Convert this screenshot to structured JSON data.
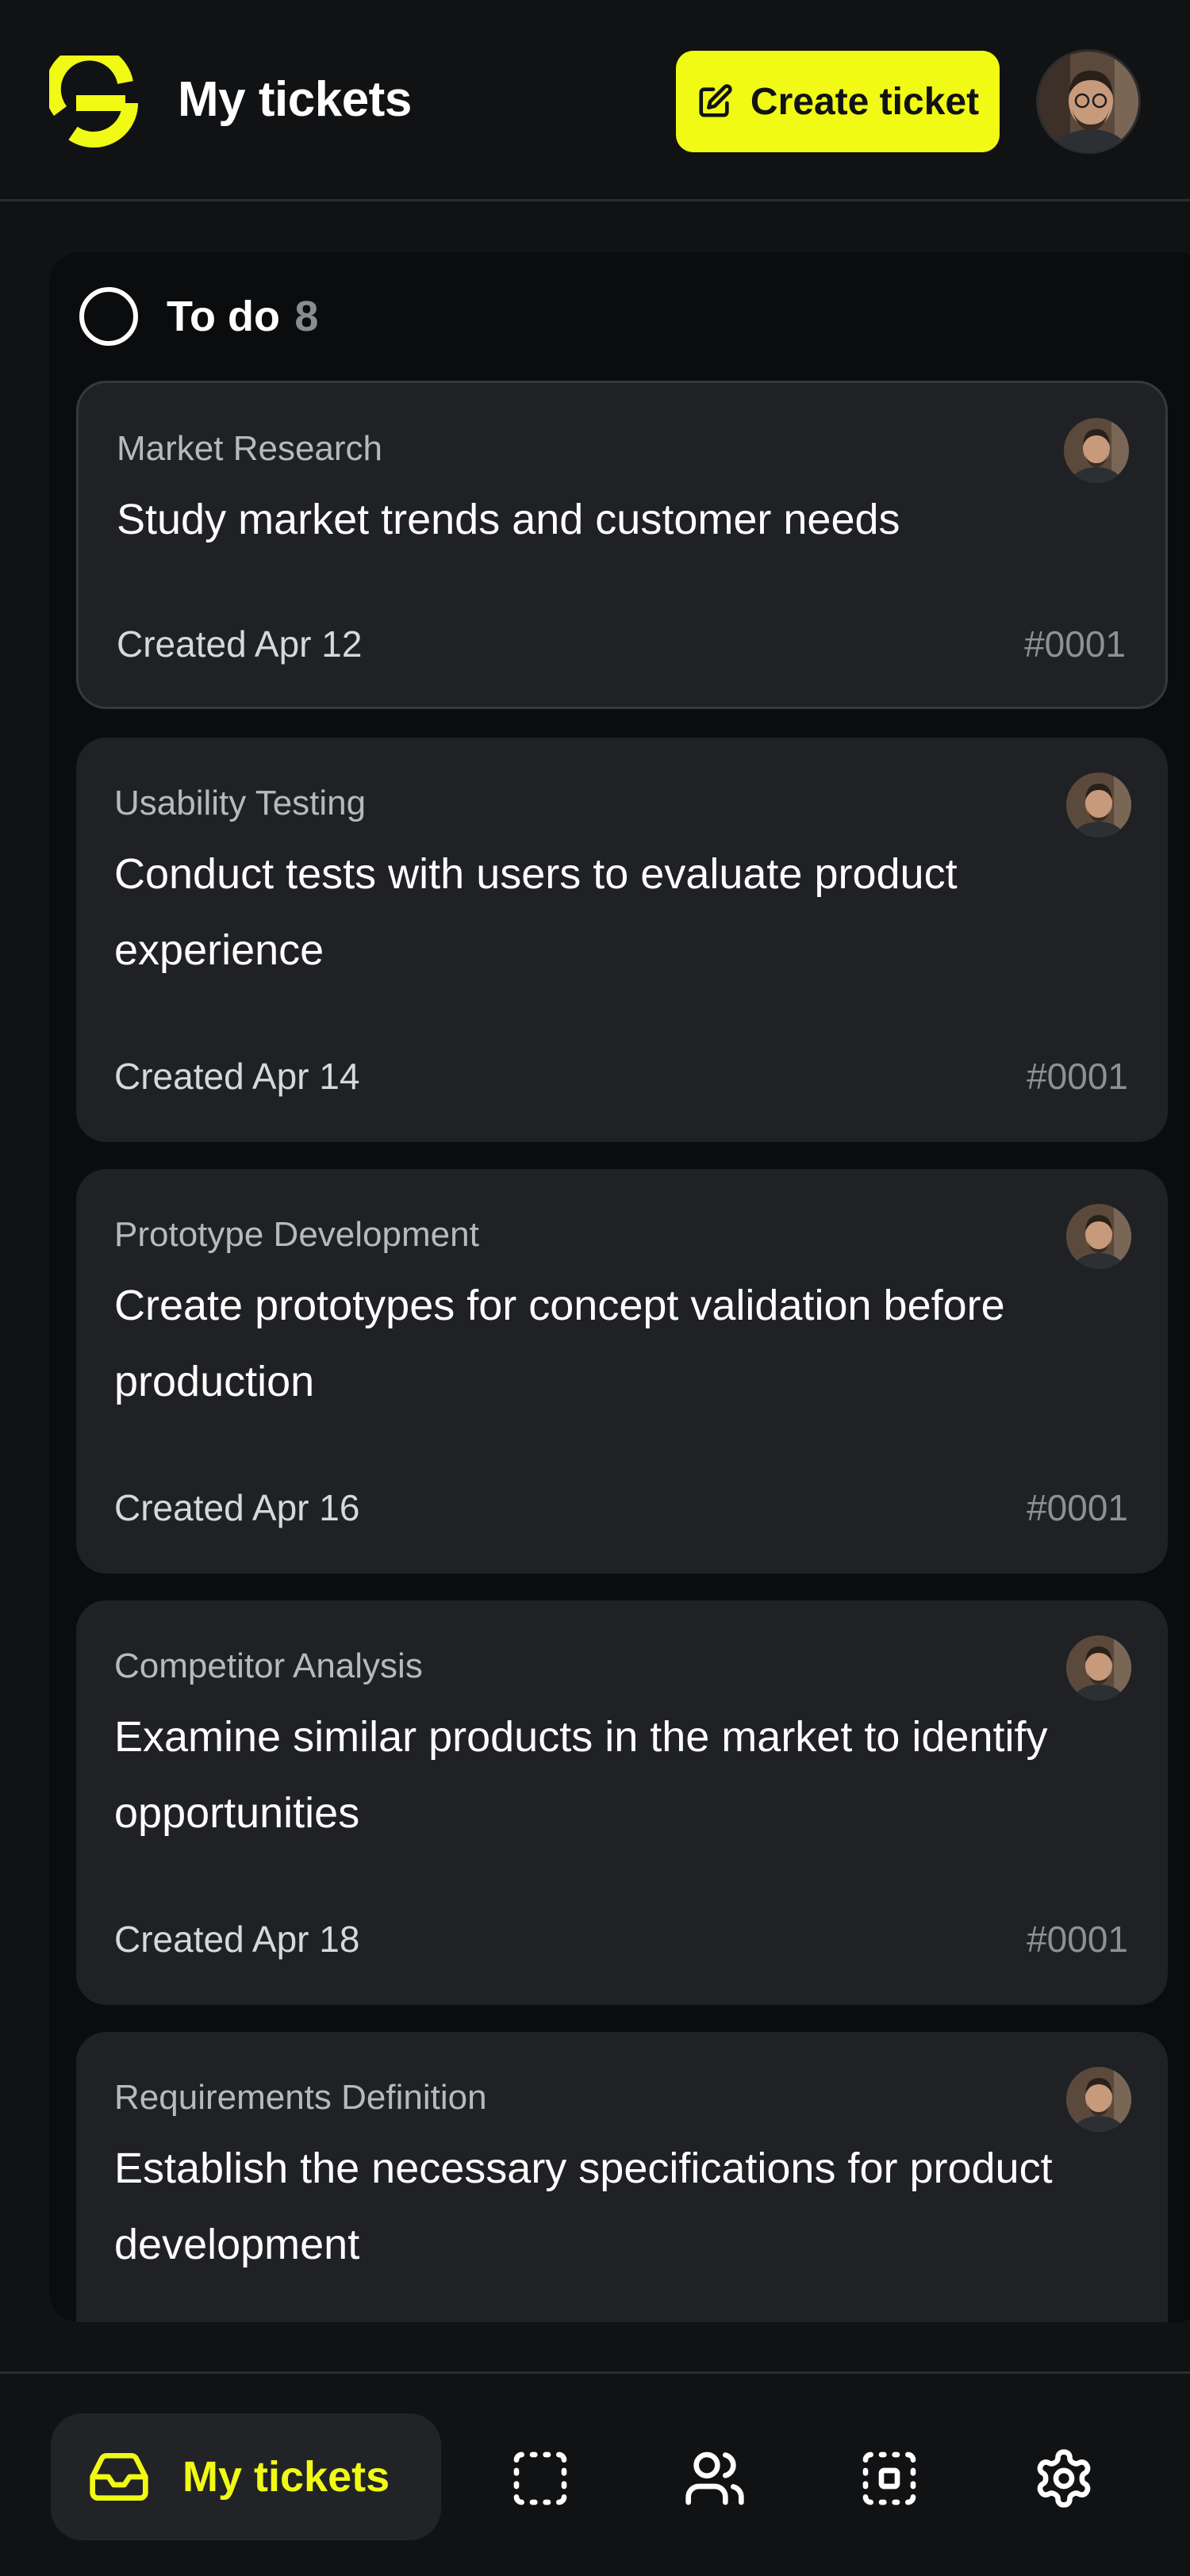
{
  "header": {
    "title": "My tickets",
    "create_label": "Create ticket",
    "accent": "#f0fa14"
  },
  "column": {
    "title": "To do",
    "count": "8"
  },
  "cards": [
    {
      "category": "Market Research",
      "title": "Study market trends and customer needs",
      "created": "Created Apr 12",
      "id": "#0001"
    },
    {
      "category": "Usability Testing",
      "title": "Conduct tests with users to evaluate product experience",
      "created": "Created Apr 14",
      "id": "#0001"
    },
    {
      "category": "Prototype Development",
      "title": "Create prototypes for concept validation before production",
      "created": "Created Apr 16",
      "id": "#0001"
    },
    {
      "category": "Competitor Analysis",
      "title": "Examine similar products in the market to identify opportunities",
      "created": "Created Apr 18",
      "id": "#0001"
    },
    {
      "category": "Requirements Definition",
      "title": "Establish the necessary specifications for product development"
    }
  ],
  "bottom_nav": {
    "active_label": "My tickets",
    "items": [
      "inbox-icon",
      "dashed-square-icon",
      "users-icon",
      "focus-square-icon",
      "gear-icon"
    ]
  }
}
